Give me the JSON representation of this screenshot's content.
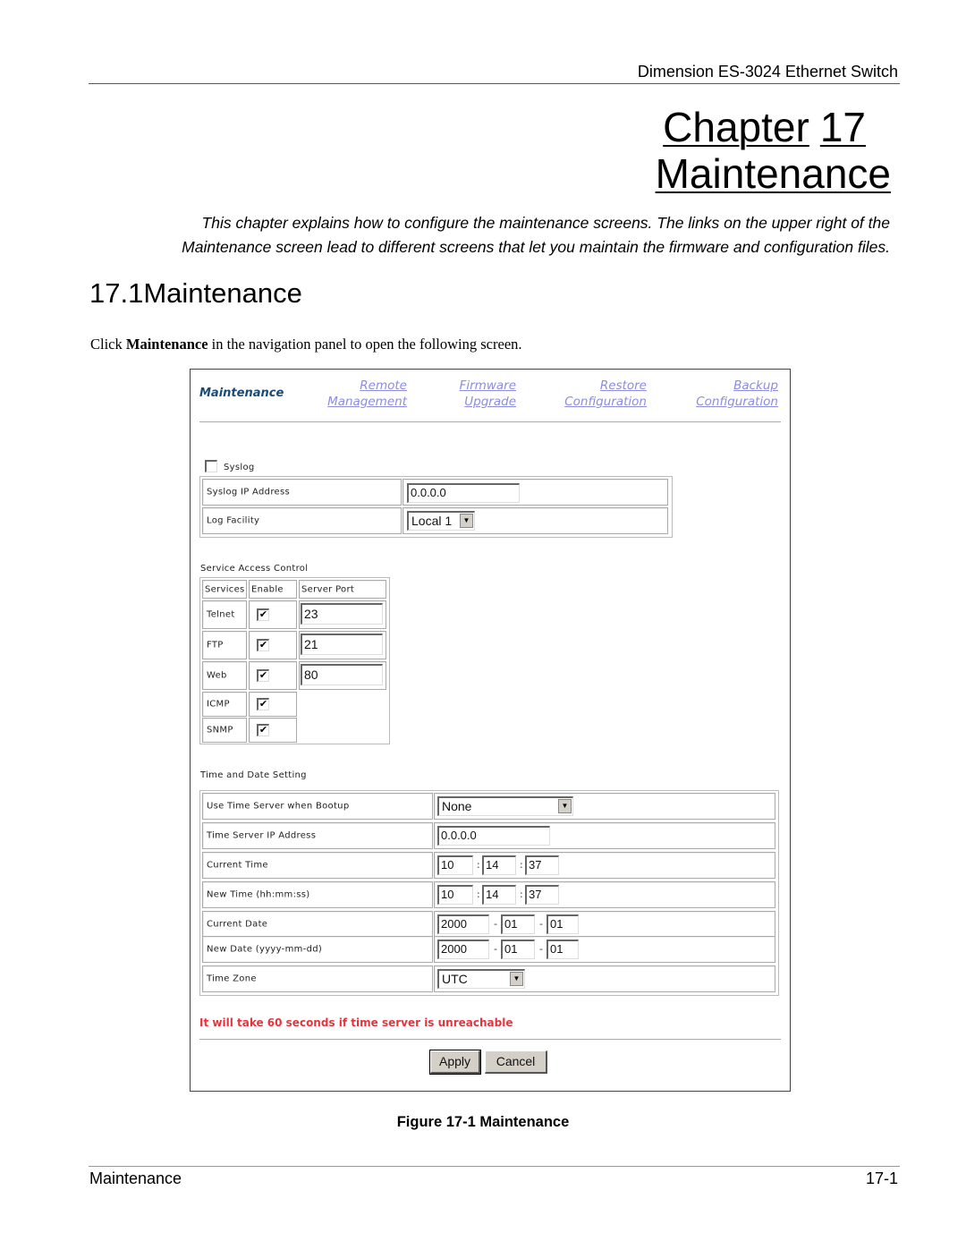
{
  "page": {
    "header": "Dimension ES-3024 Ethernet Switch",
    "chapter_label": "Chapter",
    "chapter_number": "17",
    "chapter_title": "Maintenance",
    "intro_line1": "This chapter explains how to configure the maintenance screens. The links on the upper right of the",
    "intro_line2": "Maintenance screen lead to different screens that let you maintain the firmware and configuration files.",
    "section_heading": "17.1Maintenance",
    "body_prefix": "Click ",
    "body_bold": "Maintenance",
    "body_suffix": " in the navigation panel to open the following screen.",
    "figure_caption": "Figure 17-1 Maintenance",
    "footer_left": "Maintenance",
    "footer_right": "17-1"
  },
  "screen": {
    "title": "Maintenance",
    "nav_links": [
      {
        "line1": "Remote",
        "line2": "Management"
      },
      {
        "line1": "Firmware",
        "line2": "Upgrade"
      },
      {
        "line1": "Restore",
        "line2": "Configuration"
      },
      {
        "line1": "Backup",
        "line2": "Configuration"
      }
    ],
    "syslog": {
      "checkbox_label": "Syslog",
      "checked": false,
      "ip_label": "Syslog IP Address",
      "ip_value": "0.0.0.0",
      "facility_label": "Log Facility",
      "facility_value": "Local 1"
    },
    "service_access": {
      "heading": "Service Access Control",
      "columns": [
        "Services",
        "Enable",
        "Server Port"
      ],
      "rows": [
        {
          "name": "Telnet",
          "enabled": true,
          "port": "23"
        },
        {
          "name": "FTP",
          "enabled": true,
          "port": "21"
        },
        {
          "name": "Web",
          "enabled": true,
          "port": "80"
        },
        {
          "name": "ICMP",
          "enabled": true,
          "port": null
        },
        {
          "name": "SNMP",
          "enabled": true,
          "port": null
        }
      ]
    },
    "time_date": {
      "heading": "Time and Date Setting",
      "time_server_label": "Use Time Server when Bootup",
      "time_server_value": "None",
      "server_ip_label": "Time Server IP Address",
      "server_ip_value": "0.0.0.0",
      "current_time_label": "Current Time",
      "current_time": [
        "10",
        "14",
        "37"
      ],
      "new_time_label": "New Time (hh:mm:ss)",
      "new_time": [
        "10",
        "14",
        "37"
      ],
      "current_date_label": "Current Date",
      "current_date": [
        "2000",
        "01",
        "01"
      ],
      "new_date_label": "New Date (yyyy-mm-dd)",
      "new_date": [
        "2000",
        "01",
        "01"
      ],
      "time_zone_label": "Time Zone",
      "time_zone_value": "UTC",
      "time_sep": ":",
      "date_sep": "-"
    },
    "warning": "It will take 60 seconds if time server is unreachable",
    "apply_label": "Apply",
    "cancel_label": "Cancel",
    "check_glyph": "✔",
    "arrow_glyph": "▼"
  }
}
